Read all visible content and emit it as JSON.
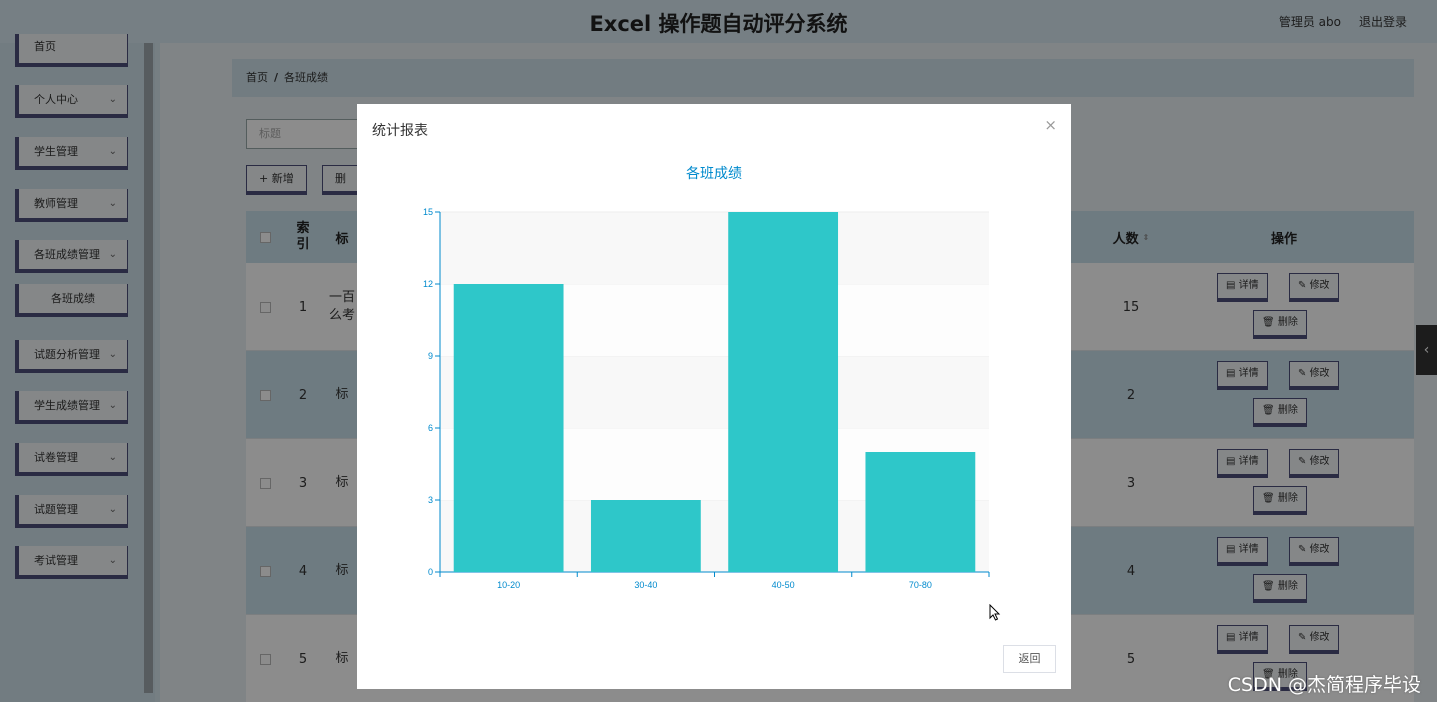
{
  "header": {
    "title": "Excel 操作题自动评分系统",
    "admin_label": "管理员 abo",
    "logout_label": "退出登录"
  },
  "sidebar": {
    "items": [
      {
        "label": "首页",
        "has_arrow": false
      },
      {
        "label": "个人中心",
        "has_arrow": true
      },
      {
        "label": "学生管理",
        "has_arrow": true
      },
      {
        "label": "教师管理",
        "has_arrow": true
      },
      {
        "label": "各班成绩管理",
        "has_arrow": true
      },
      {
        "label": "各班成绩",
        "has_arrow": false
      },
      {
        "label": "试题分析管理",
        "has_arrow": true
      },
      {
        "label": "学生成绩管理",
        "has_arrow": true
      },
      {
        "label": "试卷管理",
        "has_arrow": true
      },
      {
        "label": "试题管理",
        "has_arrow": true
      },
      {
        "label": "考试管理",
        "has_arrow": true
      }
    ]
  },
  "breadcrumb": {
    "home": "首页",
    "separator": "/",
    "current": "各班成绩"
  },
  "search": {
    "placeholder": "标题"
  },
  "toolbar": {
    "add_label": "+ 新增",
    "delete_label": "删"
  },
  "table": {
    "headers": {
      "index": "索\n引",
      "title": "标",
      "count": "人数",
      "actions": "操作"
    },
    "rows": [
      {
        "index": "1",
        "title": "一百\n么考",
        "count": "15"
      },
      {
        "index": "2",
        "title": "标",
        "count": "2"
      },
      {
        "index": "3",
        "title": "标",
        "count": "3"
      },
      {
        "index": "4",
        "title": "标",
        "count": "4"
      },
      {
        "index": "5",
        "title": "标",
        "count": "5"
      }
    ],
    "actions": {
      "detail": "详情",
      "edit": "修改",
      "delete": "删除"
    }
  },
  "modal": {
    "title": "统计报表",
    "close": "×",
    "return_label": "返回"
  },
  "chart_data": {
    "type": "bar",
    "title": "各班成绩",
    "categories": [
      "10-20",
      "30-40",
      "40-50",
      "70-80"
    ],
    "values": [
      12,
      3,
      15,
      5
    ],
    "ylim": [
      0,
      15
    ],
    "yticks": [
      0,
      3,
      6,
      9,
      12,
      15
    ],
    "grid": true,
    "colors": {
      "bar": "#2ec7c9",
      "axis": "#008acd",
      "title": "#008acd"
    }
  },
  "watermark": "CSDN @杰简程序毕设"
}
